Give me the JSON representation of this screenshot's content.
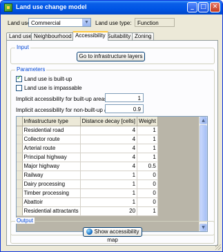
{
  "window": {
    "title": "Land use change model",
    "controls": {
      "minimize": "_",
      "maximize": "□",
      "close": "✕"
    }
  },
  "header": {
    "land_use_label": "Land use:",
    "land_use_value": "Commercial",
    "land_use_type_label": "Land use type:",
    "land_use_type_value": "Function"
  },
  "tabs": [
    "Land use",
    "Neighbourhood",
    "Accessibility",
    "Suitability",
    "Zoning"
  ],
  "input_group": {
    "title": "Input",
    "button": "Go to infrastructure layers"
  },
  "parameters_group": {
    "title": "Parameters",
    "checkbox_built_up": "Land use is built-up",
    "checkbox_impassable": "Land use is impassable",
    "built_up_label": "Implicit accessibility for built-up areas:",
    "built_up_value": "1",
    "non_built_up_label": "Implicit accessibility for non-built-up areas:",
    "non_built_up_value": "0.9"
  },
  "table": {
    "headers": [
      "Infrastructure type",
      "Distance decay [cells]",
      "Weight"
    ],
    "rows": [
      [
        "Residential road",
        "4",
        "1"
      ],
      [
        "Collector route",
        "4",
        "1"
      ],
      [
        "Arterial route",
        "4",
        "1"
      ],
      [
        "Principal highway",
        "4",
        "1"
      ],
      [
        "Major highway",
        "4",
        "0.5"
      ],
      [
        "Railway",
        "1",
        "0"
      ],
      [
        "Dairy processing",
        "1",
        "0"
      ],
      [
        "Timber processing",
        "1",
        "0"
      ],
      [
        "Abattoir",
        "1",
        "0"
      ],
      [
        "Residential attractants",
        "20",
        "1"
      ]
    ]
  },
  "output_group": {
    "title": "Output",
    "button": "Show accessibility map"
  },
  "colors": {
    "title_bar": "#0055e5",
    "group_title": "#0046d5",
    "window_bg": "#ece9d8"
  }
}
